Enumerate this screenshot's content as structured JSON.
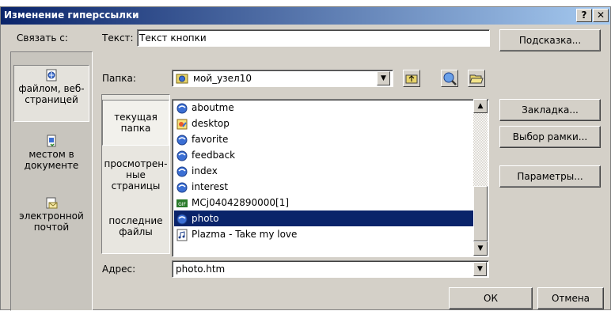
{
  "title": "Изменение гиперссылки",
  "title_buttons": {
    "help": "?",
    "close": "✕"
  },
  "link_to_label": "Связать с:",
  "text_label": "Текст:",
  "text_value": "Текст кнопки",
  "hint_button": "Подсказка...",
  "nav": {
    "file_web": "файлом, веб-страницей",
    "place_in_doc": "местом в документе",
    "email": "электронной почтой"
  },
  "folder_label": "Папка:",
  "folder_value": "мой_узел10",
  "subnav": {
    "current_folder": "текущая папка",
    "browsed_pages": "просмотрен-ные страницы",
    "recent_files": "последние файлы"
  },
  "files": [
    {
      "name": "aboutme",
      "icon": "html-file-icon"
    },
    {
      "name": "desktop",
      "icon": "image-file-icon"
    },
    {
      "name": "favorite",
      "icon": "html-file-icon"
    },
    {
      "name": "feedback",
      "icon": "html-file-icon"
    },
    {
      "name": "index",
      "icon": "html-file-icon"
    },
    {
      "name": "interest",
      "icon": "html-file-icon"
    },
    {
      "name": "MCj04042890000[1]",
      "icon": "gif-file-icon"
    },
    {
      "name": "photo",
      "icon": "html-file-icon"
    },
    {
      "name": "Plazma - Take my love",
      "icon": "audio-file-icon"
    }
  ],
  "selected_file": "photo",
  "right_buttons": {
    "bookmark": "Закладка...",
    "frame": "Выбор рамки...",
    "params": "Параметры..."
  },
  "address_label": "Адрес:",
  "address_value": "photo.htm",
  "ok": "ОК",
  "cancel": "Отмена",
  "colors": {
    "title_start": "#0a246a",
    "title_end": "#a6caf0",
    "selection": "#0a246a",
    "face": "#d4d0c8"
  }
}
